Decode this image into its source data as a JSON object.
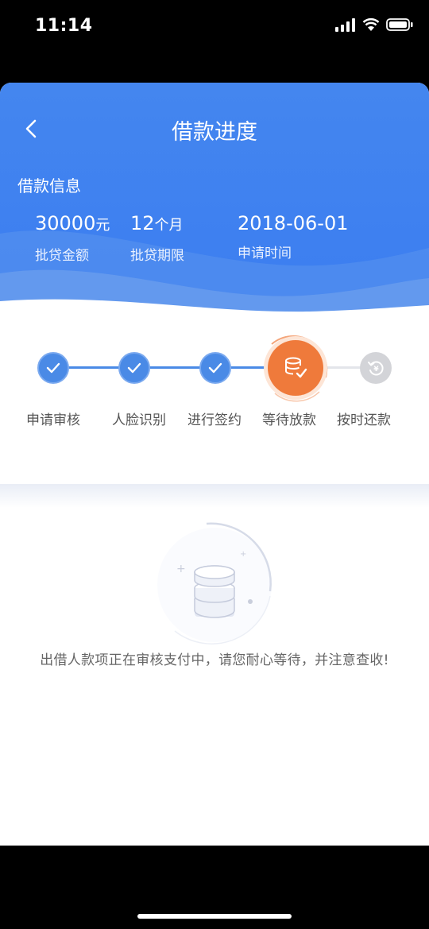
{
  "status_bar": {
    "time": "11:14"
  },
  "header": {
    "title": "借款进度",
    "section_title": "借款信息",
    "items": [
      {
        "value": "30000",
        "unit": "元",
        "label": "批贷金额"
      },
      {
        "value": "12",
        "unit": "个月",
        "label": "批贷期限"
      },
      {
        "value": "2018-06-01",
        "unit": "",
        "label": "申请时间"
      }
    ]
  },
  "steps": [
    {
      "label": "申请审核",
      "state": "done"
    },
    {
      "label": "人脸识别",
      "state": "done"
    },
    {
      "label": "进行签约",
      "state": "done"
    },
    {
      "label": "等待放款",
      "state": "active"
    },
    {
      "label": "按时还款",
      "state": "pending"
    }
  ],
  "notice": {
    "text": "出借人款项正在审核支付中，请您耐心等待，并注意查收!"
  },
  "colors": {
    "primary": "#3b7df0",
    "step_done": "#4a8ae6",
    "step_active": "#ef7a3b",
    "step_pending": "#d3d4d8"
  }
}
